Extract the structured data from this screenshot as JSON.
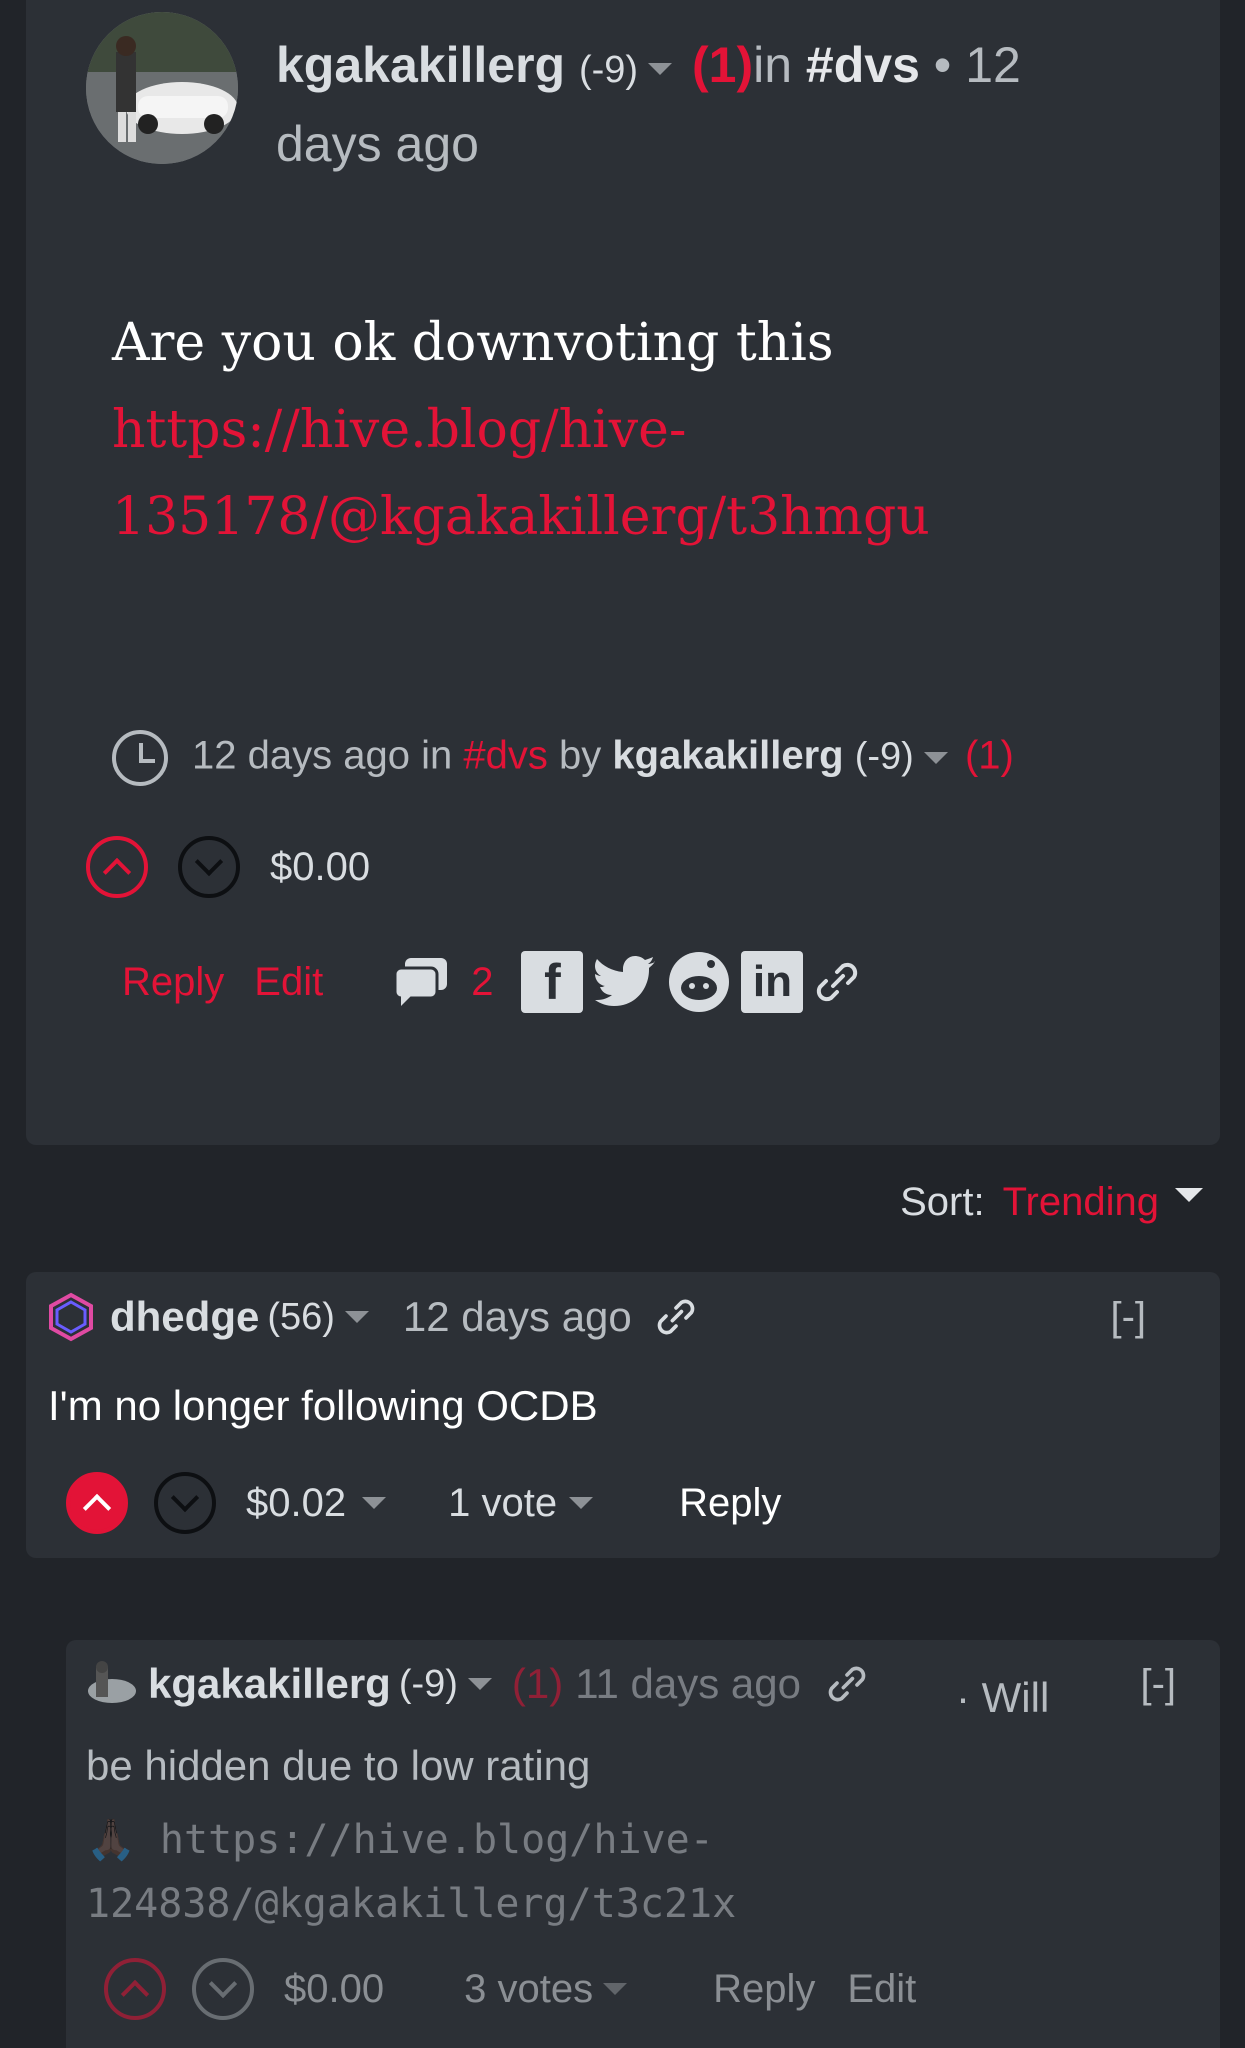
{
  "post": {
    "author": "kgakakillerg",
    "reputation": "(-9)",
    "flag_count": "(1)",
    "in_word": "in",
    "community": "#dvs",
    "separator": "•",
    "age": "12 days ago",
    "body_text": "Are you ok downvoting this",
    "body_link_line1": "https://hive.blog/hive-",
    "body_link_line2": "135178/@kgakakillerg/t3hmgu",
    "footer_age": "12 days ago in",
    "footer_community": "#dvs",
    "footer_by": "by",
    "footer_author": "kgakakillerg",
    "footer_reputation": "(-9)",
    "footer_flags": "(1)",
    "payout": "$0.00",
    "reply_label": "Reply",
    "edit_label": "Edit",
    "comment_count": "2",
    "share_icons": [
      "facebook-icon",
      "twitter-icon",
      "reddit-icon",
      "linkedin-icon",
      "link-icon"
    ]
  },
  "sort": {
    "label": "Sort:",
    "value": "Trending"
  },
  "comments": [
    {
      "author": "dhedge",
      "reputation": "(56)",
      "age": "12 days ago",
      "collapse": "[-]",
      "body": "I'm no longer following OCDB",
      "payout": "$0.02",
      "votes": "1 vote",
      "reply_label": "Reply"
    },
    {
      "author": "kgakakillerg",
      "reputation": "(-9)",
      "flag_count": "(1)",
      "age": "11 days ago",
      "hidden_note": "· Will be hidden due to low rating",
      "collapse": "[-]",
      "body_emoji": "🙏🏿",
      "body_line1": "https://hive.blog/hive-",
      "body_line2": "124838/@kgakakillerg/t3c21x",
      "payout": "$0.00",
      "votes": "3 votes",
      "reply_label": "Reply",
      "edit_label": "Edit"
    }
  ],
  "colors": {
    "accent": "#e31337",
    "background": "#212429",
    "card": "#2c3036"
  }
}
